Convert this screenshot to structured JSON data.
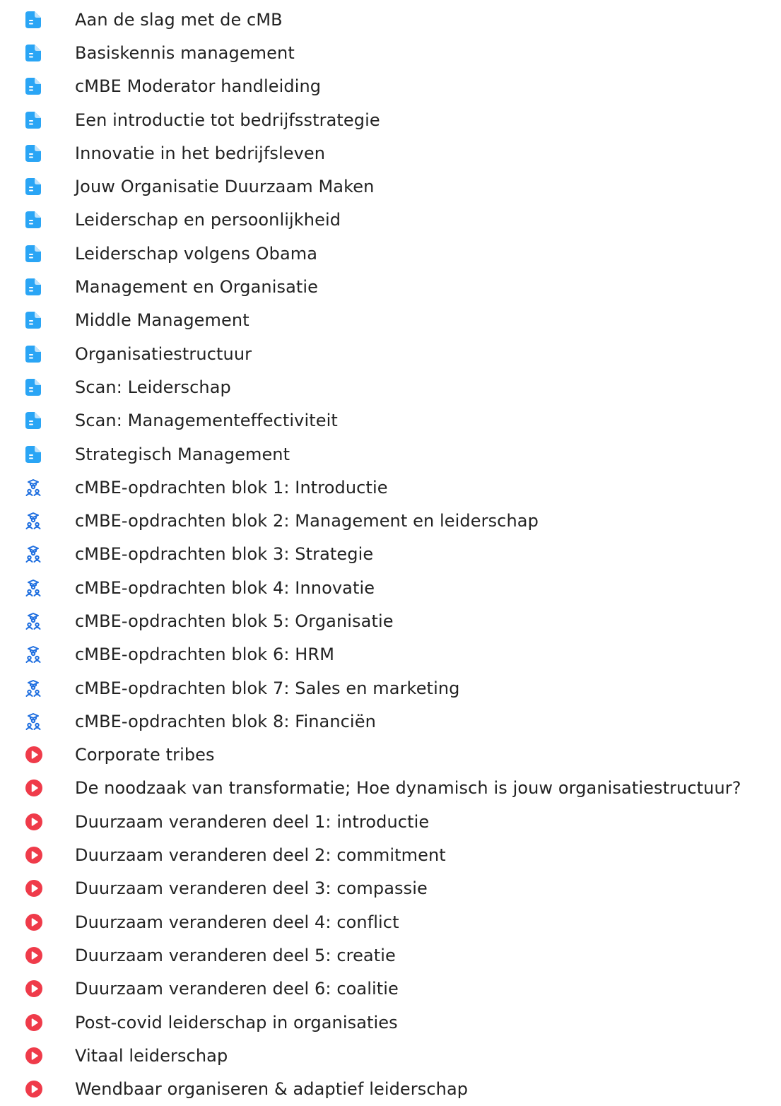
{
  "colors": {
    "document": "#2aa5f5",
    "assignment": "#1f6fe0",
    "video": "#ef3b4a",
    "text": "#222222"
  },
  "items": [
    {
      "type": "document",
      "icon": "document-icon",
      "label": "Aan de slag met de cMB"
    },
    {
      "type": "document",
      "icon": "document-icon",
      "label": "Basiskennis management"
    },
    {
      "type": "document",
      "icon": "document-icon",
      "label": "cMBE Moderator handleiding"
    },
    {
      "type": "document",
      "icon": "document-icon",
      "label": "Een introductie tot bedrijfsstrategie"
    },
    {
      "type": "document",
      "icon": "document-icon",
      "label": "Innovatie in het bedrijfsleven"
    },
    {
      "type": "document",
      "icon": "document-icon",
      "label": "Jouw Organisatie Duurzaam Maken"
    },
    {
      "type": "document",
      "icon": "document-icon",
      "label": "Leiderschap en persoonlijkheid"
    },
    {
      "type": "document",
      "icon": "document-icon",
      "label": "Leiderschap volgens Obama"
    },
    {
      "type": "document",
      "icon": "document-icon",
      "label": "Management en Organisatie"
    },
    {
      "type": "document",
      "icon": "document-icon",
      "label": "Middle Management"
    },
    {
      "type": "document",
      "icon": "document-icon",
      "label": "Organisatiestructuur"
    },
    {
      "type": "document",
      "icon": "document-icon",
      "label": "Scan: Leiderschap"
    },
    {
      "type": "document",
      "icon": "document-icon",
      "label": "Scan: Managementeffectiviteit"
    },
    {
      "type": "document",
      "icon": "document-icon",
      "label": "Strategisch Management"
    },
    {
      "type": "assignment",
      "icon": "group-graduation-icon",
      "label": "cMBE-opdrachten blok 1: Introductie"
    },
    {
      "type": "assignment",
      "icon": "group-graduation-icon",
      "label": "cMBE-opdrachten blok 2: Management en leiderschap"
    },
    {
      "type": "assignment",
      "icon": "group-graduation-icon",
      "label": "cMBE-opdrachten blok 3: Strategie"
    },
    {
      "type": "assignment",
      "icon": "group-graduation-icon",
      "label": "cMBE-opdrachten blok 4: Innovatie"
    },
    {
      "type": "assignment",
      "icon": "group-graduation-icon",
      "label": "cMBE-opdrachten blok 5: Organisatie"
    },
    {
      "type": "assignment",
      "icon": "group-graduation-icon",
      "label": "cMBE-opdrachten blok 6: HRM"
    },
    {
      "type": "assignment",
      "icon": "group-graduation-icon",
      "label": "cMBE-opdrachten blok 7: Sales en marketing"
    },
    {
      "type": "assignment",
      "icon": "group-graduation-icon",
      "label": "cMBE-opdrachten blok 8: Financiën"
    },
    {
      "type": "video",
      "icon": "play-icon",
      "label": "Corporate tribes"
    },
    {
      "type": "video",
      "icon": "play-icon",
      "label": "De noodzaak van transformatie; Hoe dynamisch is jouw organisatiestructuur?"
    },
    {
      "type": "video",
      "icon": "play-icon",
      "label": "Duurzaam veranderen deel 1: introductie"
    },
    {
      "type": "video",
      "icon": "play-icon",
      "label": "Duurzaam veranderen deel 2: commitment"
    },
    {
      "type": "video",
      "icon": "play-icon",
      "label": "Duurzaam veranderen deel 3: compassie"
    },
    {
      "type": "video",
      "icon": "play-icon",
      "label": "Duurzaam veranderen deel 4: conflict"
    },
    {
      "type": "video",
      "icon": "play-icon",
      "label": "Duurzaam veranderen deel 5: creatie"
    },
    {
      "type": "video",
      "icon": "play-icon",
      "label": "Duurzaam veranderen deel 6: coalitie"
    },
    {
      "type": "video",
      "icon": "play-icon",
      "label": "Post-covid leiderschap in organisaties"
    },
    {
      "type": "video",
      "icon": "play-icon",
      "label": "Vitaal leiderschap"
    },
    {
      "type": "video",
      "icon": "play-icon",
      "label": "Wendbaar organiseren & adaptief leiderschap"
    }
  ]
}
